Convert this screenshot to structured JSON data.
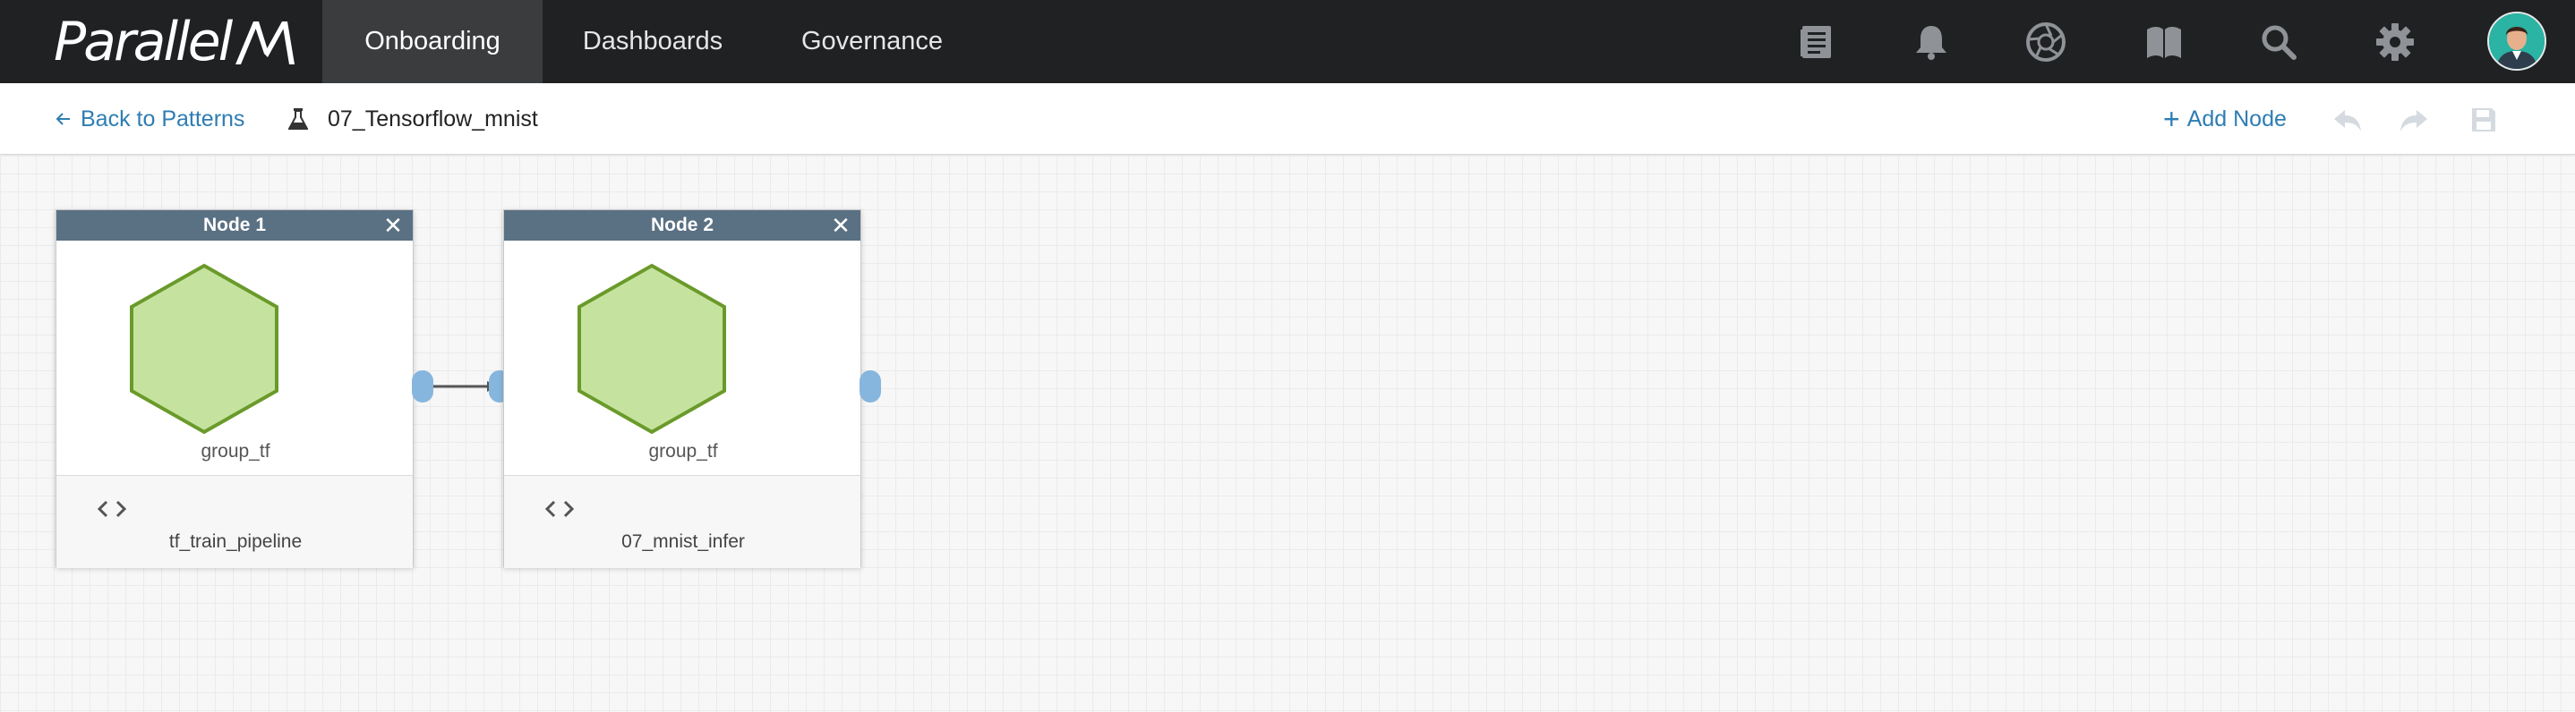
{
  "nav": {
    "logo_text": "Parallel",
    "tabs": [
      {
        "label": "Onboarding",
        "active": true
      },
      {
        "label": "Dashboards",
        "active": false
      },
      {
        "label": "Governance",
        "active": false
      }
    ],
    "icons": [
      "notes-icon",
      "bell-icon",
      "aperture-icon",
      "book-icon",
      "search-icon",
      "gear-icon",
      "user-avatar"
    ]
  },
  "toolbar": {
    "back_label": "Back to Patterns",
    "pattern_name": "07_Tensorflow_mnist",
    "add_node_label": "Add Node",
    "icons": [
      "undo-icon",
      "redo-icon",
      "save-icon"
    ]
  },
  "nodes": [
    {
      "title": "Node 1",
      "group": "group_tf",
      "pipeline": "tf_train_pipeline"
    },
    {
      "title": "Node 2",
      "group": "group_tf",
      "pipeline": "07_mnist_infer"
    }
  ],
  "colors": {
    "nav_bg": "#1f2123",
    "accent": "#2e7db3",
    "node_header": "#5a7184",
    "hexagon_fill": "#c5e39e",
    "hexagon_stroke": "#6a9a2a",
    "port": "#86b6de"
  }
}
